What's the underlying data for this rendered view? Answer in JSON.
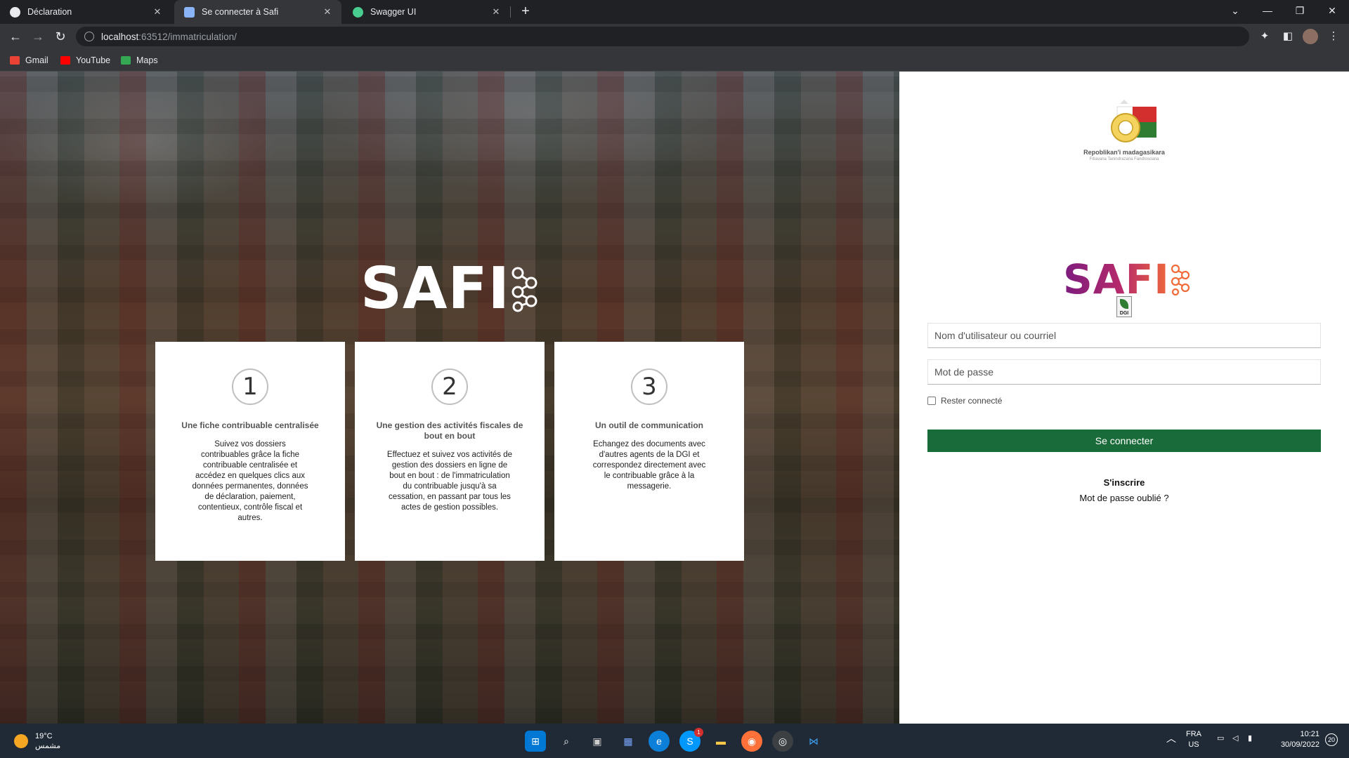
{
  "browser": {
    "tabs": [
      {
        "title": "Déclaration",
        "favicon_color": "#e8eaed"
      },
      {
        "title": "Se connecter à Safi",
        "favicon_color": "#8ab4f8"
      },
      {
        "title": "Swagger UI",
        "favicon_color": "#49cc90"
      }
    ],
    "new_tab_label": "+",
    "url_host": "localhost",
    "url_path": ":63512/immatriculation/",
    "bookmarks": [
      {
        "label": "Gmail",
        "icon": "gmail-icon",
        "color": "#ea4335"
      },
      {
        "label": "YouTube",
        "icon": "youtube-icon",
        "color": "#ff0000"
      },
      {
        "label": "Maps",
        "icon": "maps-icon",
        "color": "#34a853"
      }
    ]
  },
  "hero": {
    "logo_text": "SAFI",
    "cards": [
      {
        "number": "1",
        "title": "Une fiche contribuable centralisée",
        "text": "Suivez vos dossiers contribuables grâce la fiche contribuable centralisée et accédez en quelques clics aux données permanentes, données de déclaration, paiement, contentieux, contrôle fiscal et autres."
      },
      {
        "number": "2",
        "title": "Une gestion des activités fiscales de bout en bout",
        "text": "Effectuez et suivez vos activités de gestion des dossiers en ligne de bout en bout : de l'immatriculation du contribuable jusqu'à sa cessation, en passant par tous les actes de gestion possibles."
      },
      {
        "number": "3",
        "title": "Un outil de communication",
        "text": "Echangez des documents avec d'autres agents de la DGI et correspondez directement avec le contribuable grâce à la messagerie."
      }
    ]
  },
  "login": {
    "emblem_name": "Repoblikan'i madagasikara",
    "emblem_motto": "Fitiavana Tanindrazana Fandrosoana",
    "logo_text": "SAFI",
    "dgi_label": "DGI",
    "username_placeholder": "Nom d'utilisateur ou courriel",
    "password_placeholder": "Mot de passe",
    "remember_label": "Rester connecté",
    "submit_label": "Se connecter",
    "signup_label": "S'inscrire",
    "forgot_label": "Mot de passe oublié ?",
    "accent_color": "#1a6b3a"
  },
  "taskbar": {
    "temperature": "19°C",
    "weather_text": "مشمس",
    "language": "FRA",
    "layout": "US",
    "time": "10:21",
    "date": "30/09/2022",
    "notification_count": "20",
    "skype_badge": "1"
  }
}
